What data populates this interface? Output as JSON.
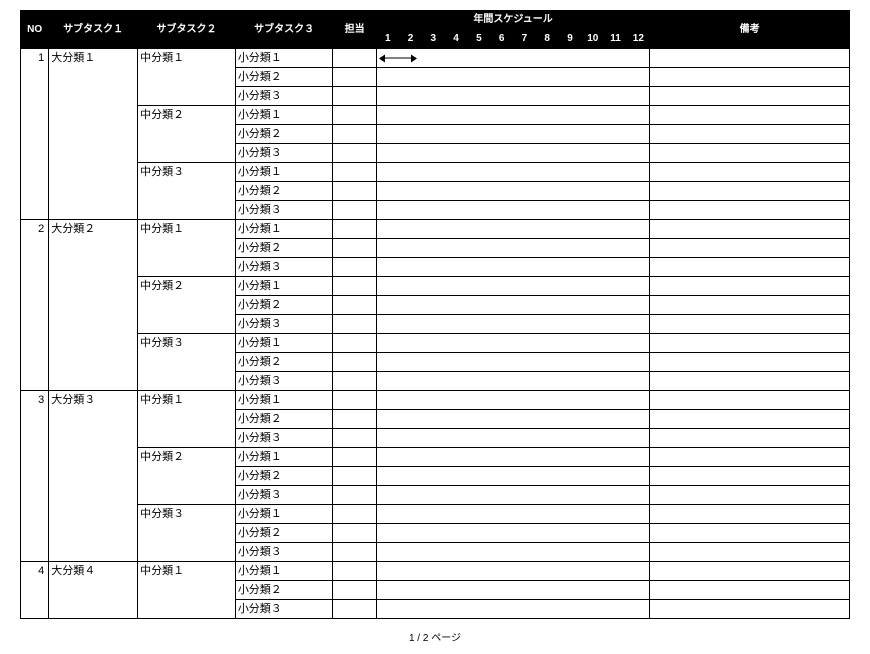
{
  "headers": {
    "no": "NO",
    "sub1": "サブタスク１",
    "sub2": "サブタスク２",
    "sub3": "サブタスク３",
    "owner": "担当",
    "schedule": "年間スケジュール",
    "note": "備考",
    "months": [
      "1",
      "2",
      "3",
      "4",
      "5",
      "6",
      "7",
      "8",
      "9",
      "10",
      "11",
      "12"
    ]
  },
  "groups": [
    {
      "no": "1",
      "sub1": "大分類１",
      "mids": [
        {
          "sub2": "中分類１",
          "subs": [
            {
              "sub3": "小分類１",
              "gantt": {
                "start": 1,
                "end": 2
              }
            },
            {
              "sub3": "小分類２"
            },
            {
              "sub3": "小分類３"
            }
          ]
        },
        {
          "sub2": "中分類２",
          "subs": [
            {
              "sub3": "小分類１"
            },
            {
              "sub3": "小分類２"
            },
            {
              "sub3": "小分類３"
            }
          ]
        },
        {
          "sub2": "中分類３",
          "subs": [
            {
              "sub3": "小分類１"
            },
            {
              "sub3": "小分類２"
            },
            {
              "sub3": "小分類３"
            }
          ]
        }
      ]
    },
    {
      "no": "2",
      "sub1": "大分類２",
      "mids": [
        {
          "sub2": "中分類１",
          "subs": [
            {
              "sub3": "小分類１"
            },
            {
              "sub3": "小分類２"
            },
            {
              "sub3": "小分類３"
            }
          ]
        },
        {
          "sub2": "中分類２",
          "subs": [
            {
              "sub3": "小分類１"
            },
            {
              "sub3": "小分類２"
            },
            {
              "sub3": "小分類３"
            }
          ]
        },
        {
          "sub2": "中分類３",
          "subs": [
            {
              "sub3": "小分類１"
            },
            {
              "sub3": "小分類２"
            },
            {
              "sub3": "小分類３"
            }
          ]
        }
      ]
    },
    {
      "no": "3",
      "sub1": "大分類３",
      "mids": [
        {
          "sub2": "中分類１",
          "subs": [
            {
              "sub3": "小分類１"
            },
            {
              "sub3": "小分類２"
            },
            {
              "sub3": "小分類３"
            }
          ]
        },
        {
          "sub2": "中分類２",
          "subs": [
            {
              "sub3": "小分類１"
            },
            {
              "sub3": "小分類２"
            },
            {
              "sub3": "小分類３"
            }
          ]
        },
        {
          "sub2": "中分類３",
          "subs": [
            {
              "sub3": "小分類１"
            },
            {
              "sub3": "小分類２"
            },
            {
              "sub3": "小分類３"
            }
          ]
        }
      ]
    },
    {
      "no": "4",
      "sub1": "大分類４",
      "mids": [
        {
          "sub2": "中分類１",
          "subs": [
            {
              "sub3": "小分類１"
            },
            {
              "sub3": "小分類２"
            },
            {
              "sub3": "小分類３"
            }
          ]
        }
      ]
    }
  ],
  "footer": "1 / 2 ページ"
}
